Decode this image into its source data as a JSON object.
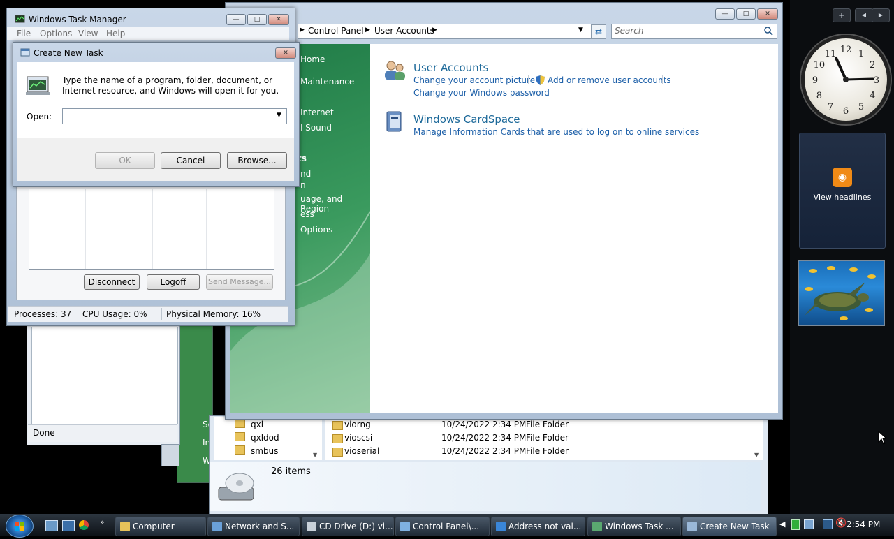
{
  "sidebar": {
    "add_label": "+",
    "prev_label": "◀",
    "next_label": "▶",
    "feed_label": "View headlines"
  },
  "clock": {
    "numbers": [
      "12",
      "1",
      "2",
      "3",
      "4",
      "5",
      "6",
      "7",
      "8",
      "9",
      "10",
      "11"
    ]
  },
  "control_panel": {
    "breadcrumb": [
      "Control Panel",
      "User Accounts"
    ],
    "search_placeholder": "Search",
    "left_links": [
      "Home",
      "Maintenance",
      "Internet",
      "l Sound",
      "ts",
      "nd",
      "n",
      "uage, and Region",
      "ess",
      "Options"
    ],
    "sections": [
      {
        "title": "User Accounts",
        "links": [
          "Change your account picture",
          "Add or remove user accounts",
          "Change your Windows password"
        ]
      },
      {
        "title": "Windows CardSpace",
        "links": [
          "Manage Information Cards that are used to log on to online services"
        ]
      }
    ]
  },
  "task_manager": {
    "title": "Windows Task Manager",
    "menu": [
      "File",
      "Options",
      "View",
      "Help"
    ],
    "buttons": {
      "disconnect": "Disconnect",
      "logoff": "Logoff",
      "send_message": "Send Message..."
    },
    "status": {
      "processes": "Processes: 37",
      "cpu": "CPU Usage: 0%",
      "memory": "Physical Memory: 16%"
    }
  },
  "create_task": {
    "title": "Create New Task",
    "description": "Type the name of a program, folder, document, or Internet resource, and Windows will open it for you.",
    "open_label": "Open:",
    "open_value": "",
    "ok": "OK",
    "cancel": "Cancel",
    "browse": "Browse..."
  },
  "computer_window": {
    "status": "Done"
  },
  "network_window": {
    "text": [
      "Se",
      "In",
      "W"
    ]
  },
  "cd_drive": {
    "tree": [
      "qxl",
      "qxldod",
      "smbus"
    ],
    "files": [
      {
        "name": "viorng",
        "date": "10/24/2022 2:34 PM",
        "type": "File Folder"
      },
      {
        "name": "vioscsi",
        "date": "10/24/2022 2:34 PM",
        "type": "File Folder"
      },
      {
        "name": "vioserial",
        "date": "10/24/2022 2:34 PM",
        "type": "File Folder"
      }
    ],
    "item_count": "26 items"
  },
  "taskbar": {
    "items": [
      {
        "label": "Computer",
        "icon": "folder-icon",
        "color": "#e6c25a"
      },
      {
        "label": "Network and S...",
        "icon": "network-icon",
        "color": "#6aa0d8"
      },
      {
        "label": "CD Drive (D:) vi...",
        "icon": "drive-icon",
        "color": "#c9d1d9"
      },
      {
        "label": "Control Panel\\...",
        "icon": "control-panel-icon",
        "color": "#7fb0e0"
      },
      {
        "label": "Address not val...",
        "icon": "ie-icon",
        "color": "#3a86d8"
      },
      {
        "label": "Windows Task ...",
        "icon": "task-manager-icon",
        "color": "#5aa870"
      },
      {
        "label": "Create New Task",
        "icon": "run-icon",
        "color": "#9ab8d8"
      }
    ],
    "time": "2:54 PM"
  }
}
